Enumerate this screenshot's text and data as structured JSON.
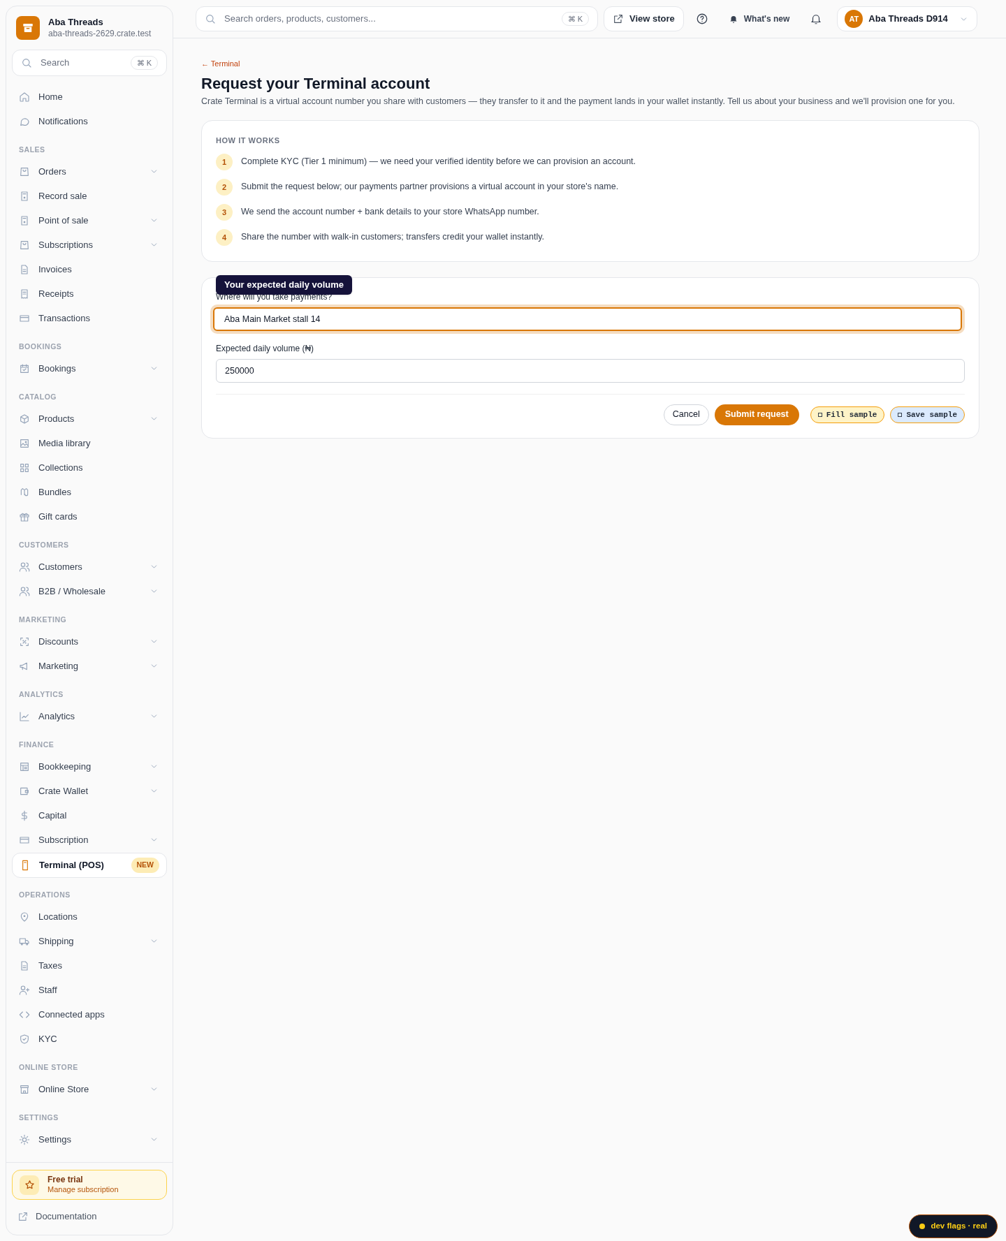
{
  "sidebar": {
    "brand": {
      "name": "Aba Threads",
      "domain": "aba-threads-2629.crate.test"
    },
    "search": {
      "placeholder": "Search",
      "shortcut": "⌘ K"
    },
    "sections": [
      {
        "items": [
          {
            "label": "Home",
            "kind": "link",
            "selected": false
          },
          {
            "label": "Notifications",
            "kind": "link",
            "selected": false
          }
        ]
      },
      {
        "title": "SALES",
        "items": [
          {
            "label": "Orders",
            "kind": "group",
            "selected": false
          },
          {
            "label": "Record sale",
            "kind": "link",
            "selected": false
          },
          {
            "label": "Point of sale",
            "kind": "group",
            "selected": false
          },
          {
            "label": "Subscriptions",
            "kind": "group",
            "selected": false
          },
          {
            "label": "Invoices",
            "kind": "link",
            "selected": false
          },
          {
            "label": "Receipts",
            "kind": "link",
            "selected": false
          },
          {
            "label": "Transactions",
            "kind": "link",
            "selected": false
          }
        ]
      },
      {
        "title": "BOOKINGS",
        "items": [
          {
            "label": "Bookings",
            "kind": "group",
            "selected": false
          }
        ]
      },
      {
        "title": "CATALOG",
        "items": [
          {
            "label": "Products",
            "kind": "group",
            "selected": false
          },
          {
            "label": "Media library",
            "kind": "link",
            "selected": false
          },
          {
            "label": "Collections",
            "kind": "link",
            "selected": false
          },
          {
            "label": "Bundles",
            "kind": "link",
            "selected": false
          },
          {
            "label": "Gift cards",
            "kind": "link",
            "selected": false
          }
        ]
      },
      {
        "title": "CUSTOMERS",
        "items": [
          {
            "label": "Customers",
            "kind": "group",
            "selected": false
          },
          {
            "label": "B2B / Wholesale",
            "kind": "group",
            "selected": false
          }
        ]
      },
      {
        "title": "MARKETING",
        "items": [
          {
            "label": "Discounts",
            "kind": "group",
            "selected": false
          },
          {
            "label": "Marketing",
            "kind": "group",
            "selected": false
          }
        ]
      },
      {
        "title": "ANALYTICS",
        "items": [
          {
            "label": "Analytics",
            "kind": "group",
            "selected": false
          }
        ]
      },
      {
        "title": "FINANCE",
        "items": [
          {
            "label": "Bookkeeping",
            "kind": "group",
            "selected": false
          },
          {
            "label": "Crate Wallet",
            "kind": "group",
            "selected": false
          },
          {
            "label": "Capital",
            "kind": "link",
            "selected": false
          },
          {
            "label": "Subscription",
            "kind": "group",
            "selected": false
          },
          {
            "label": "Terminal (POS)",
            "kind": "link",
            "selected": true,
            "badge": "NEW"
          }
        ]
      },
      {
        "title": "OPERATIONS",
        "items": [
          {
            "label": "Locations",
            "kind": "link",
            "selected": false
          },
          {
            "label": "Shipping",
            "kind": "group",
            "selected": false
          },
          {
            "label": "Taxes",
            "kind": "link",
            "selected": false
          },
          {
            "label": "Staff",
            "kind": "link",
            "selected": false
          },
          {
            "label": "Connected apps",
            "kind": "link",
            "selected": false
          },
          {
            "label": "KYC",
            "kind": "link",
            "selected": false
          }
        ]
      },
      {
        "title": "ONLINE STORE",
        "items": [
          {
            "label": "Online Store",
            "kind": "group",
            "selected": false
          }
        ]
      },
      {
        "title": "SETTINGS",
        "items": [
          {
            "label": "Settings",
            "kind": "group",
            "selected": false
          }
        ]
      }
    ],
    "trial": {
      "title": "Free trial",
      "subtitle": "Manage subscription"
    },
    "documentation": "Documentation"
  },
  "topbar": {
    "search": {
      "placeholder": "Search orders, products, customers...",
      "shortcut": "⌘ K"
    },
    "view_store": "View store",
    "whats_new": "What's new",
    "account": {
      "initials": "AT",
      "name": "Aba Threads D914"
    }
  },
  "page": {
    "back_link": "← Terminal",
    "title": "Request your Terminal account",
    "description": "Crate Terminal is a virtual account number you share with customers — they transfer to it and the payment lands in your wallet instantly. Tell us about your business and we'll provision one for you.",
    "how_it_works": {
      "heading": "HOW IT WORKS",
      "steps": [
        {
          "number": "1",
          "text": "Complete KYC (Tier 1 minimum) — we need your verified identity before we can provision an account."
        },
        {
          "number": "2",
          "text": "Submit the request below; our payments partner provisions a virtual account in your store's name."
        },
        {
          "number": "3",
          "text": "We send the account number + bank details to your store WhatsApp number."
        },
        {
          "number": "4",
          "text": "Share the number with walk-in customers; transfers credit your wallet instantly."
        }
      ]
    },
    "form": {
      "tooltip": "Your expected daily volume",
      "fields": [
        {
          "label": "Where will you take payments?",
          "value": "Aba Main Market stall 14",
          "focused": true
        },
        {
          "label": "Expected daily volume (₦)",
          "value": "250000",
          "focused": false
        }
      ],
      "cancel": "Cancel",
      "submit": "Submit request",
      "dev_buttons": [
        {
          "label": "Fill sample",
          "kind": "fill"
        },
        {
          "label": "Save sample",
          "kind": "save"
        }
      ]
    }
  },
  "dev_flags": "dev flags · real"
}
